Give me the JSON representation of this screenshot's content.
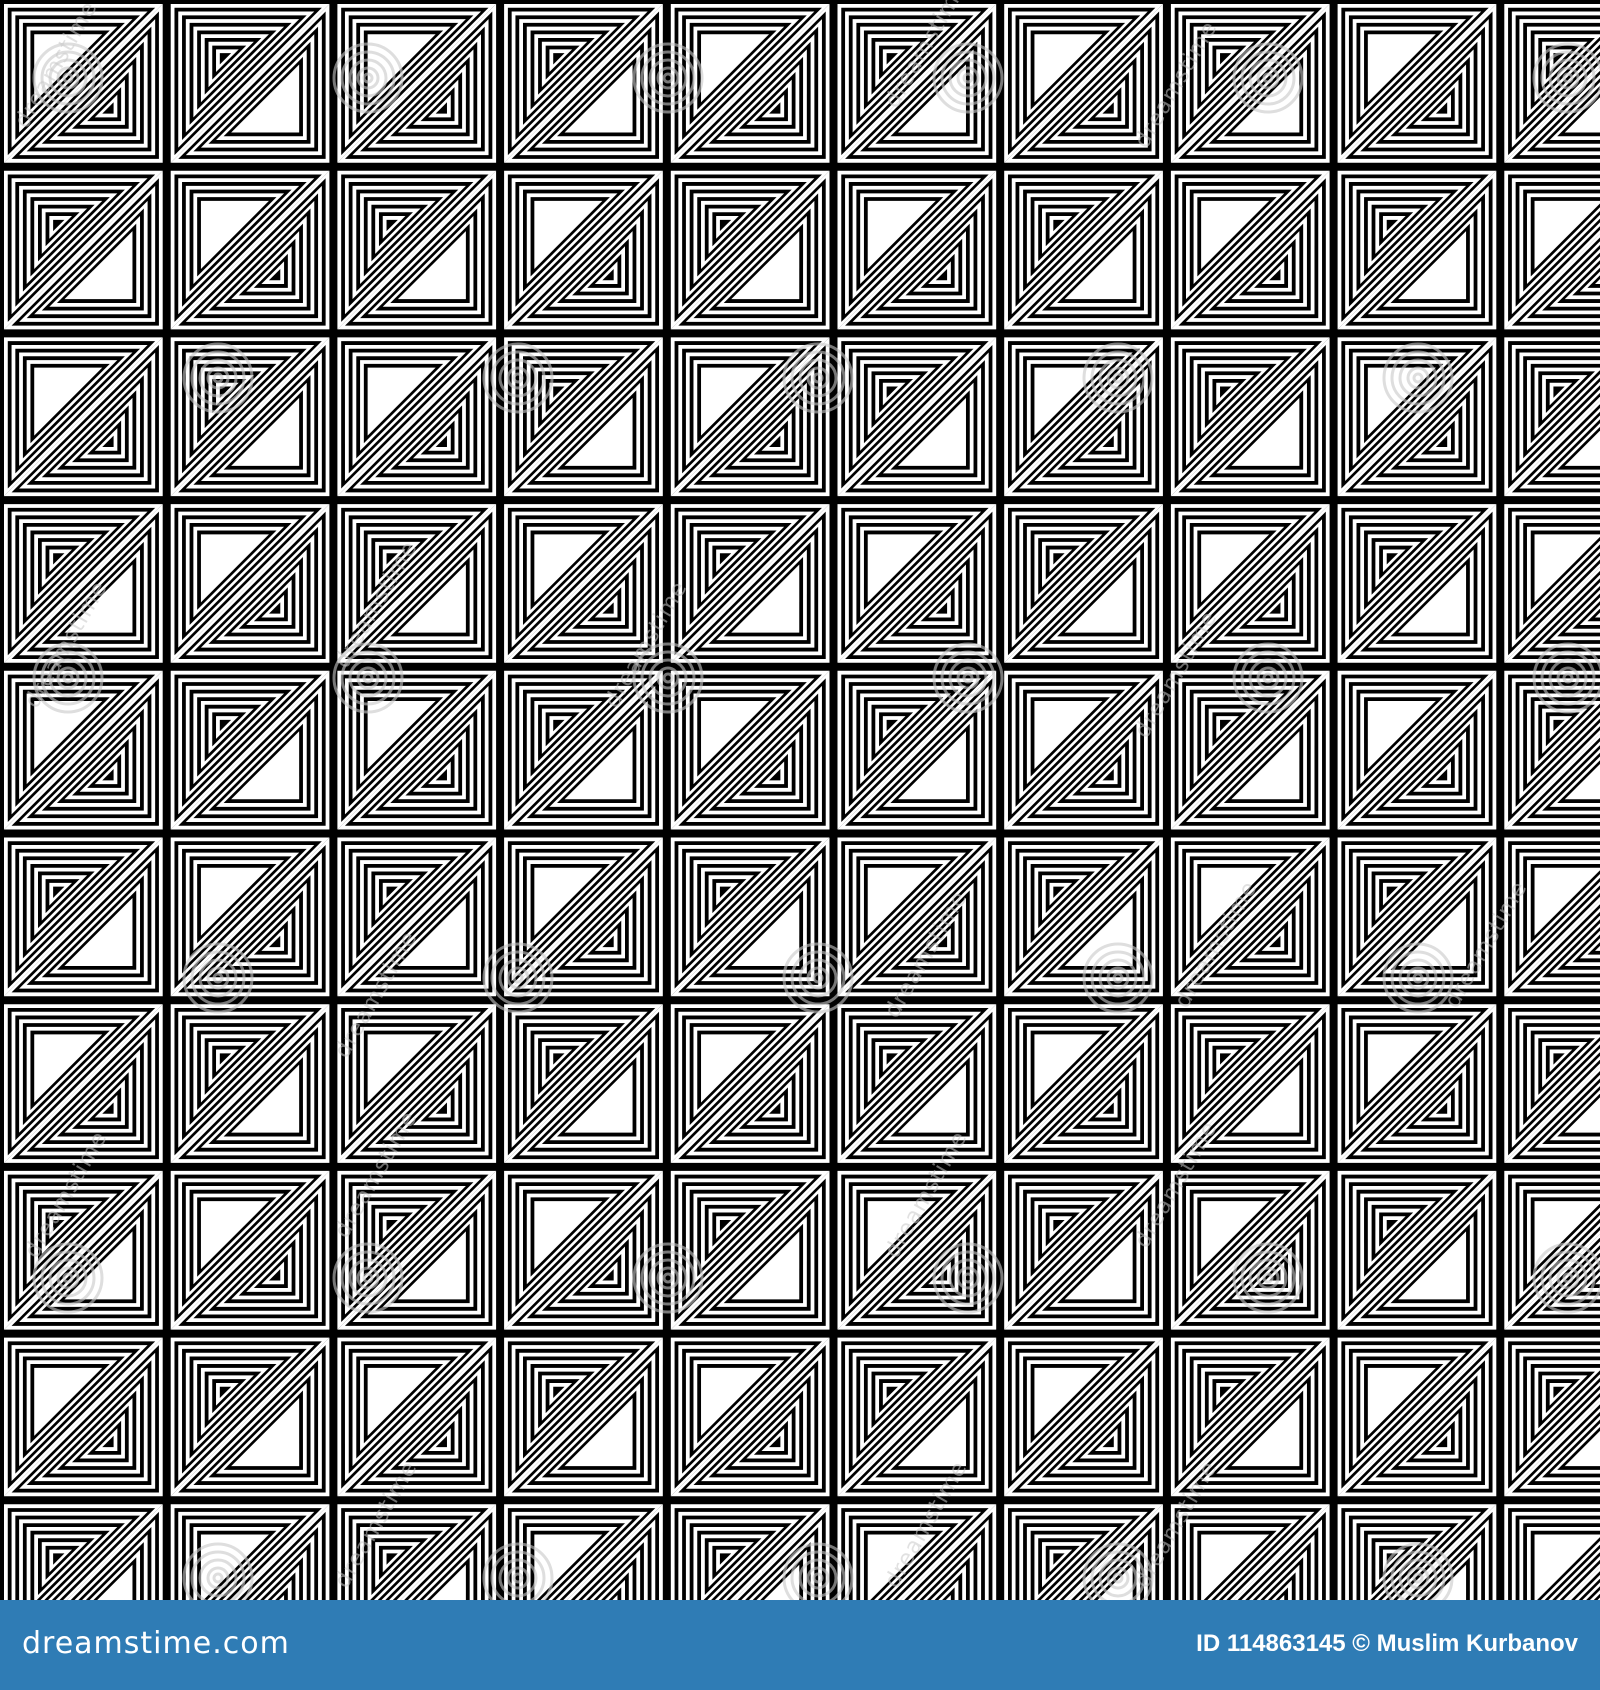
{
  "image": {
    "colors": {
      "ink": "#000000",
      "paper": "#ffffff",
      "footer": "#2f7cb5",
      "watermark": "#c8c8c8"
    }
  },
  "watermark": {
    "text": "dreamstime",
    "icon": "dreamstime-spiral-icon"
  },
  "footer": {
    "logo": "dreamstime.com",
    "image_id": "ID 114863145 © Muslim Kurbanov"
  }
}
